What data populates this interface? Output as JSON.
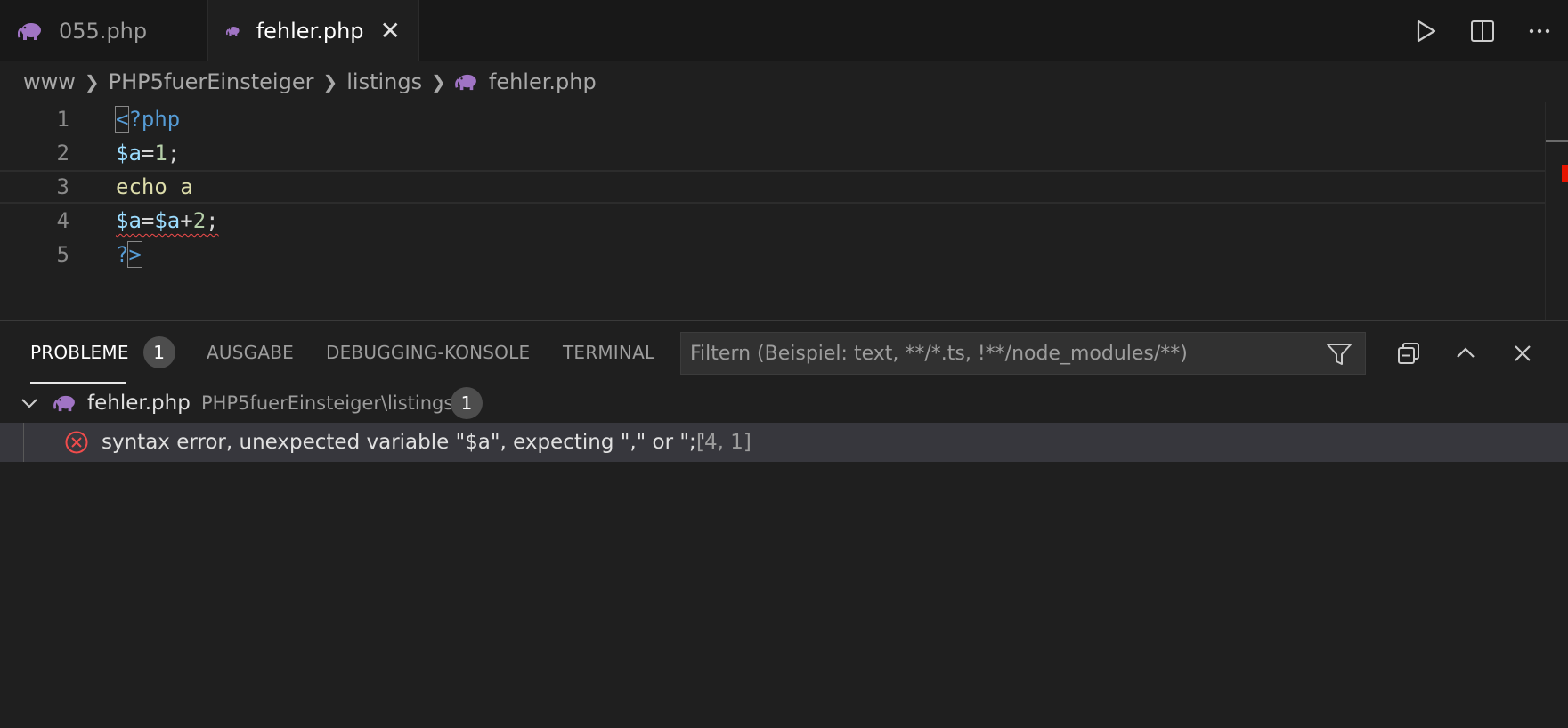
{
  "tabs": [
    {
      "label": "055.php",
      "active": false
    },
    {
      "label": "fehler.php",
      "active": true
    }
  ],
  "tab_actions": {
    "run": "play-icon",
    "split": "split-editor-icon",
    "more": "more-icon"
  },
  "breadcrumb": {
    "items": [
      "www",
      "PHP5fuerEinsteiger",
      "listings"
    ],
    "file": "fehler.php"
  },
  "editor": {
    "line_numbers": [
      "1",
      "2",
      "3",
      "4",
      "5"
    ],
    "line1": {
      "bracket": "<",
      "rest": "?php"
    },
    "line2": {
      "var": "$a",
      "op": "=",
      "num": "1",
      "end": ";"
    },
    "line3": {
      "kw": "echo",
      "arg": " a"
    },
    "line4": {
      "var1": "$a",
      "op1": "=",
      "var2": "$a",
      "op2": "+",
      "num": "2",
      "end": ";"
    },
    "line5": {
      "q": "?",
      "bracket": ">"
    }
  },
  "panel": {
    "tabs": {
      "problems": "PROBLEME",
      "problems_count": "1",
      "output": "AUSGABE",
      "debug": "DEBUGGING-KONSOLE",
      "terminal": "TERMINAL"
    },
    "filter_placeholder": "Filtern (Beispiel: text, **/*.ts, !**/node_modules/**)",
    "file_group": {
      "name": "fehler.php",
      "path": "PHP5fuerEinsteiger\\listings",
      "count": "1"
    },
    "problem": {
      "message": "syntax error, unexpected variable \"$a\", expecting \",\" or \";\"",
      "position": "[4, 1]"
    }
  },
  "colors": {
    "error": "#f14c4c",
    "php_icon": "#a074c4",
    "keyword": "#569cd6",
    "variable": "#9cdcfe",
    "number": "#b5cea8"
  }
}
